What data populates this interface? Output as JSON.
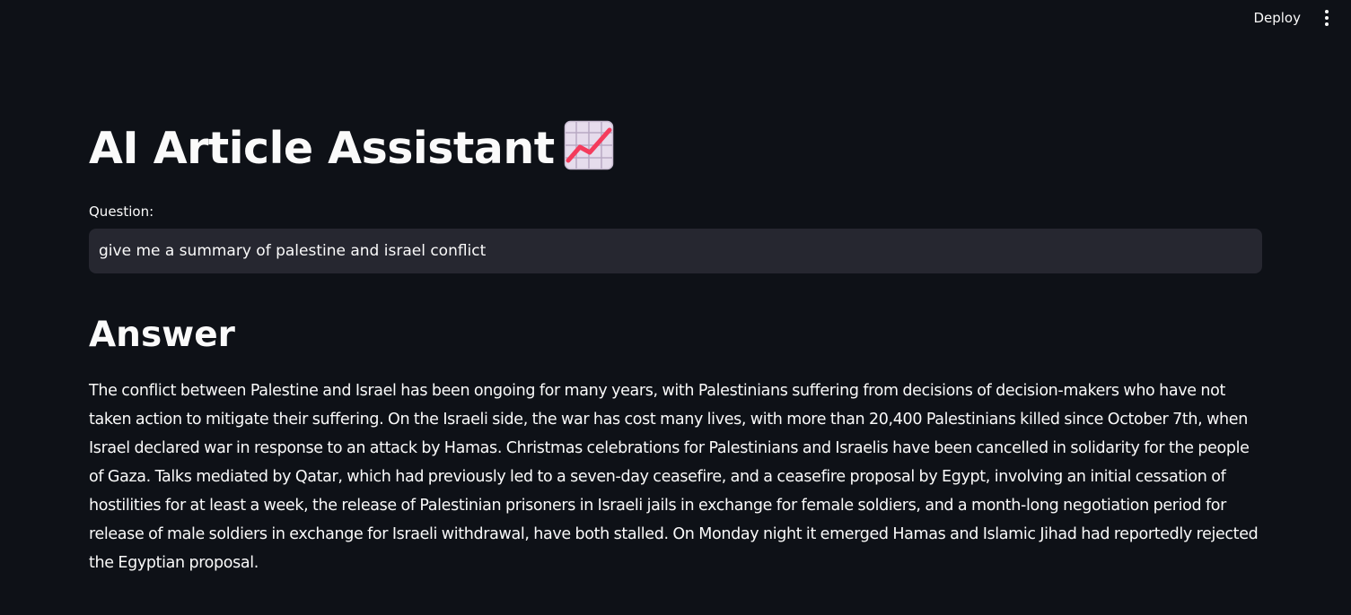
{
  "header": {
    "deploy_label": "Deploy",
    "menu_icon": "vertical-ellipsis-icon"
  },
  "main": {
    "title": "AI Article Assistant",
    "title_icon": "chart-increasing-icon",
    "question_label": "Question:",
    "question_value": "give me a summary of palestine and israel conflict",
    "answer_heading": "Answer",
    "answer_text": "The conflict between Palestine and Israel has been ongoing for many years, with Palestinians suffering from decisions of decision-makers who have not taken action to mitigate their suffering. On the Israeli side, the war has cost many lives, with more than 20,400 Palestinians killed since October 7th, when Israel declared war in response to an attack by Hamas. Christmas celebrations for Palestinians and Israelis have been cancelled in solidarity for the people of Gaza. Talks mediated by Qatar, which had previously led to a seven-day ceasefire, and a ceasefire proposal by Egypt, involving an initial cessation of hostilities for at least a week, the release of Palestinian prisoners in Israeli jails in exchange for female soldiers, and a month-long negotiation period for release of male soldiers in exchange for Israeli withdrawal, have both stalled. On Monday night it emerged Hamas and Islamic Jihad had reportedly rejected the Egyptian proposal."
  },
  "colors": {
    "background": "#0e1117",
    "text": "#fafafa",
    "input_background": "#262730",
    "icon_line": "#f43b5c"
  }
}
